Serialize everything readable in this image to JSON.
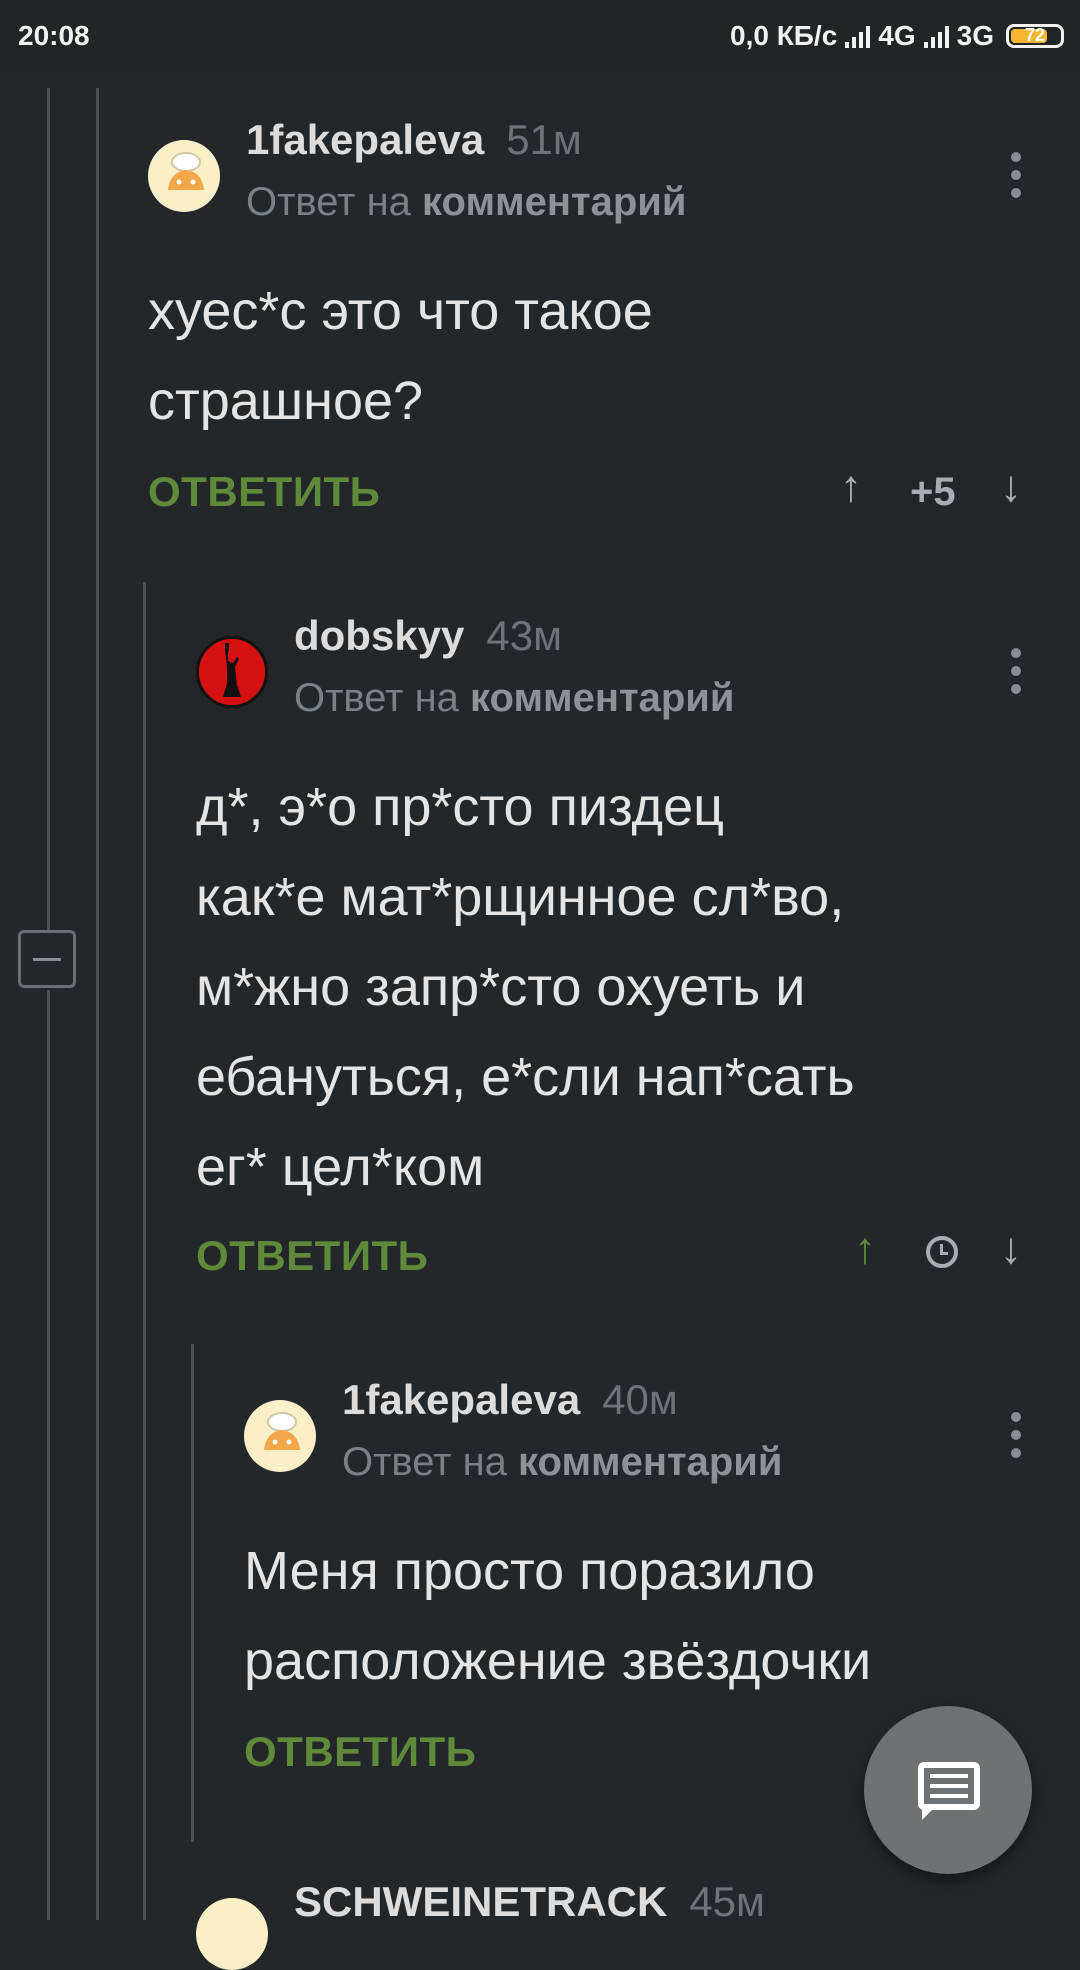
{
  "status_bar": {
    "time": "20:08",
    "net_speed": "0,0 КБ/с",
    "net1": "4G",
    "net2": "3G",
    "battery": "72"
  },
  "comments": [
    {
      "author": "1fakepaleva",
      "time": "51м",
      "reply_prefix": "Ответ на",
      "reply_target": "комментарий",
      "text": "хуес*с это что такое\nстрашное?",
      "reply_label": "ОТВЕТИТЬ",
      "score": "+5"
    },
    {
      "author": "dobskyy",
      "time": "43м",
      "reply_prefix": "Ответ на",
      "reply_target": "комментарий",
      "text": "д*, э*о пр*сто пиздец\nкак*е мат*рщинное сл*во,\nм*жно запр*сто охуеть и\nебануться, е*сли нап*сать\nег* цел*ком",
      "reply_label": "ОТВЕТИТЬ"
    },
    {
      "author": "1fakepaleva",
      "time": "40м",
      "reply_prefix": "Ответ на",
      "reply_target": "комментарий",
      "text": "Меня просто поразило\nрасположение звёздочки",
      "reply_label": "ОТВЕТИТЬ"
    },
    {
      "author": "SCHWEINETRACK",
      "time": "45м"
    }
  ],
  "icons": {
    "upvote": "↑",
    "downvote": "↓"
  },
  "colors": {
    "background": "#23272a",
    "accent_green": "#5f8a3a"
  }
}
